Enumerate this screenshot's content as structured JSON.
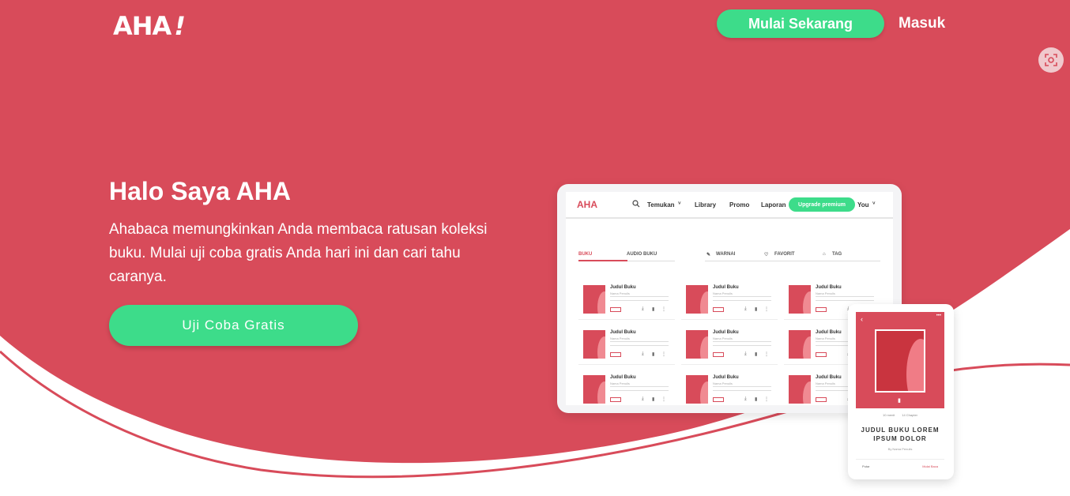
{
  "brand": {
    "logo_text": "AHA",
    "logo_bang": "!"
  },
  "header": {
    "start_label": "Mulai Sekarang",
    "login_label": "Masuk"
  },
  "hero": {
    "title": "Halo Saya AHA",
    "description": "Ahabaca memungkinkan Anda membaca ratusan koleksi buku. Mulai uji coba gratis Anda hari ini dan cari tahu caranya.",
    "cta_label": "Uji Coba Gratis"
  },
  "colors": {
    "hero": "#d84b5a",
    "accent_green": "#3ddc8a"
  },
  "tablet": {
    "logo": "AHA",
    "nav": [
      "Temukan",
      "Library",
      "Promo",
      "Laporan"
    ],
    "upgrade_label": "Upgrade premium",
    "user_label": "You",
    "tabs": [
      "BUKU",
      "AUDIO BUKU",
      "WARNAI",
      "FAVORIT",
      "TAG"
    ],
    "card_title": "Judul Buku",
    "card_author": "Nama Penulis"
  },
  "phone": {
    "book_title": "JUDUL BUKU LOREM IPSUM DOLOR",
    "author": "By Nama Penulis",
    "meta_left": "10 menit",
    "meta_right": "14 Chapter",
    "footer_left": "Putar",
    "footer_right": "Mulai Baca"
  },
  "icons": [
    "search-icon",
    "chevron-down-icon",
    "pencil-icon",
    "heart-icon",
    "tag-icon",
    "download-icon",
    "bookmark-icon",
    "more-icon",
    "capture-icon",
    "back-icon"
  ]
}
